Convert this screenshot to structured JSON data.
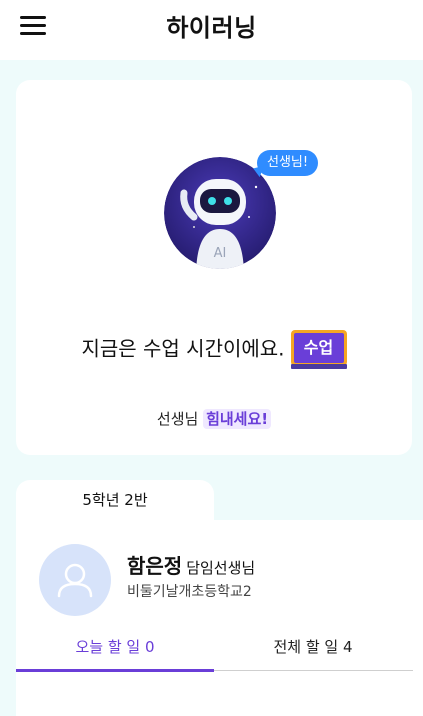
{
  "app": {
    "title": "하이러닝"
  },
  "hero": {
    "bubble": "선생님!",
    "avatar_badge": "AI",
    "message": "지금은 수업 시간이에요.",
    "board_label": "수업",
    "cheer_prefix": "선생님 ",
    "cheer_highlight": "힘내세요!"
  },
  "class": {
    "tab_label": "5학년 2반"
  },
  "profile": {
    "name": "함은정",
    "role": "담임선생님",
    "school": "비둘기날개초등학교2"
  },
  "tabs": [
    {
      "label": "오늘 할 일 0",
      "active": true
    },
    {
      "label": "전체 할 일 4",
      "active": false
    }
  ],
  "colors": {
    "accent": "#6a3ed8",
    "bubble": "#2f8cff",
    "background": "#eefbfb"
  },
  "icons": {
    "menu": "hamburger-icon",
    "robot": "ai-robot-illustration",
    "user": "user-icon",
    "board": "chalkboard-icon"
  }
}
